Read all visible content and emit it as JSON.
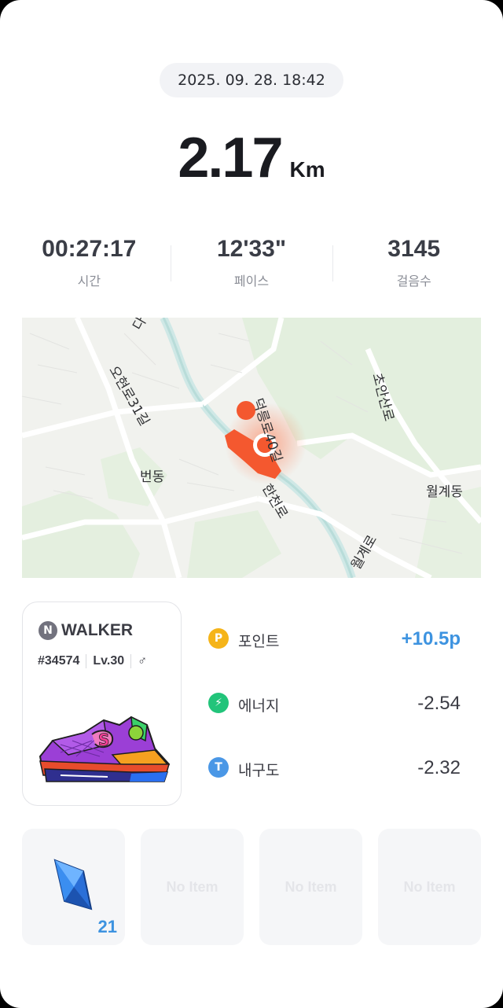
{
  "datetime": "2025. 09. 28. 18:42",
  "distance": {
    "value": "2.17",
    "unit": "Km"
  },
  "stats": [
    {
      "value": "00:27:17",
      "label": "시간"
    },
    {
      "value": "12'33\"",
      "label": "페이스"
    },
    {
      "value": "3145",
      "label": "걸음수"
    }
  ],
  "map": {
    "labels": [
      "오현로31길",
      "번동",
      "덕릉로40길",
      "한천로",
      "초안산로",
      "월계동",
      "월계로",
      "다"
    ]
  },
  "nft": {
    "logo_letter": "N",
    "brand": "WALKER",
    "id": "#34574",
    "level": "Lv.30",
    "gender_symbol": "♂"
  },
  "rewards": [
    {
      "icon": "point-icon",
      "icon_letter": "P",
      "name": "포인트",
      "amount": "+10.5p",
      "color": "#f5b419"
    },
    {
      "icon": "energy-icon",
      "icon_letter": "⚡",
      "name": "에너지",
      "amount": "-2.54",
      "color": "#22c47a"
    },
    {
      "icon": "durability-icon",
      "icon_letter": "T",
      "name": "내구도",
      "amount": "-2.32",
      "color": "#4a97e6"
    }
  ],
  "items": [
    {
      "icon": "blue-gem-icon",
      "count": "21"
    },
    {
      "empty_label": "No Item"
    },
    {
      "empty_label": "No Item"
    },
    {
      "empty_label": "No Item"
    }
  ]
}
